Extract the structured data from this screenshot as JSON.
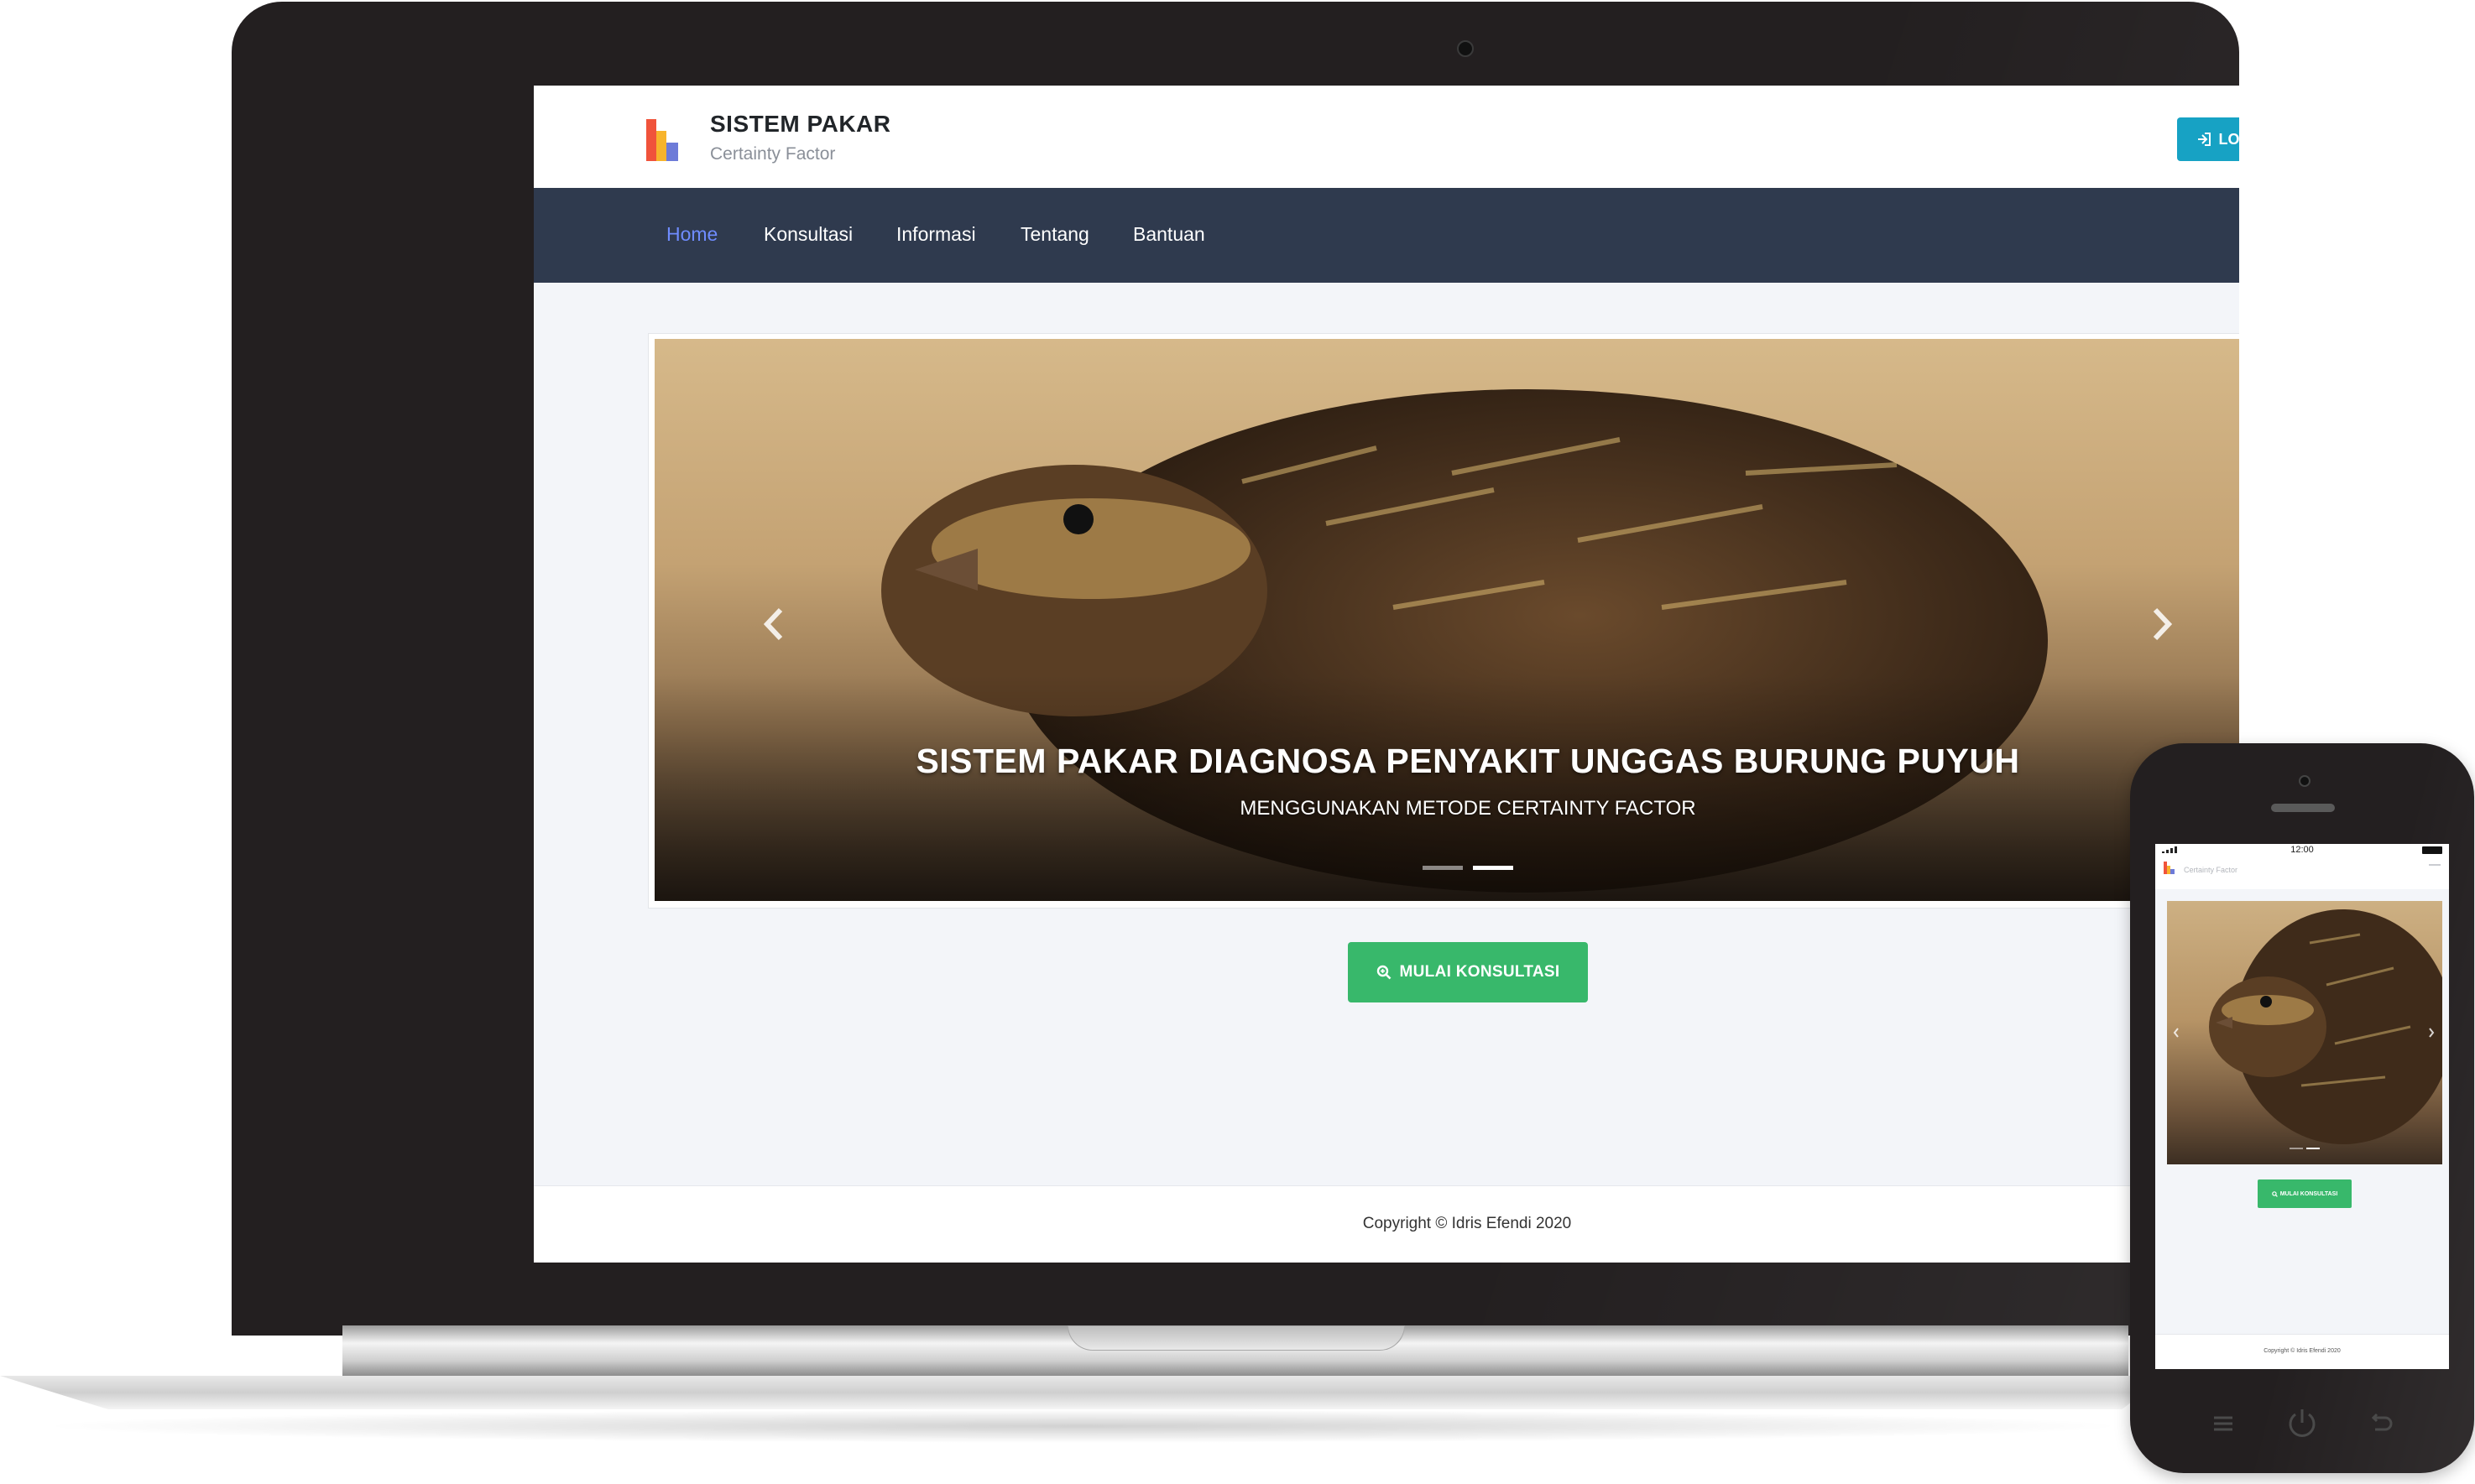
{
  "site": {
    "brand": {
      "title": "SISTEM PAKAR",
      "subtitle": "Certainty Factor"
    },
    "login_label": "LOGIN",
    "nav": [
      {
        "label": "Home",
        "active": true
      },
      {
        "label": "Konsultasi",
        "active": false
      },
      {
        "label": "Informasi",
        "active": false
      },
      {
        "label": "Tentang",
        "active": false
      },
      {
        "label": "Bantuan",
        "active": false
      }
    ],
    "slider": {
      "title": "SISTEM PAKAR DIAGNOSA PENYAKIT UNGGAS BURUNG PUYUH",
      "subtitle": "MENGGUNAKAN METODE CERTAINTY FACTOR",
      "slide_count": 2,
      "active_index": 1
    },
    "cta_label": "MULAI KONSULTASI",
    "copyright": "Copyright © Idris Efendi 2020"
  },
  "phone": {
    "time": "12:00",
    "brand_subtitle": "Certainty Factor",
    "cta_label": "MULAI KONSULTASI",
    "copyright": "Copyright © Idris Efendi 2020"
  },
  "colors": {
    "navbar": "#2f3a4e",
    "nav_active": "#6f8cff",
    "login_button": "#17a2c4",
    "cta_button": "#38b86b",
    "device_frame": "#231f20"
  },
  "icons": {
    "logo": "bar-chart-logo-icon",
    "login": "sign-in-icon",
    "cta": "search-zoom-icon",
    "prev": "chevron-left-icon",
    "next": "chevron-right-icon"
  }
}
